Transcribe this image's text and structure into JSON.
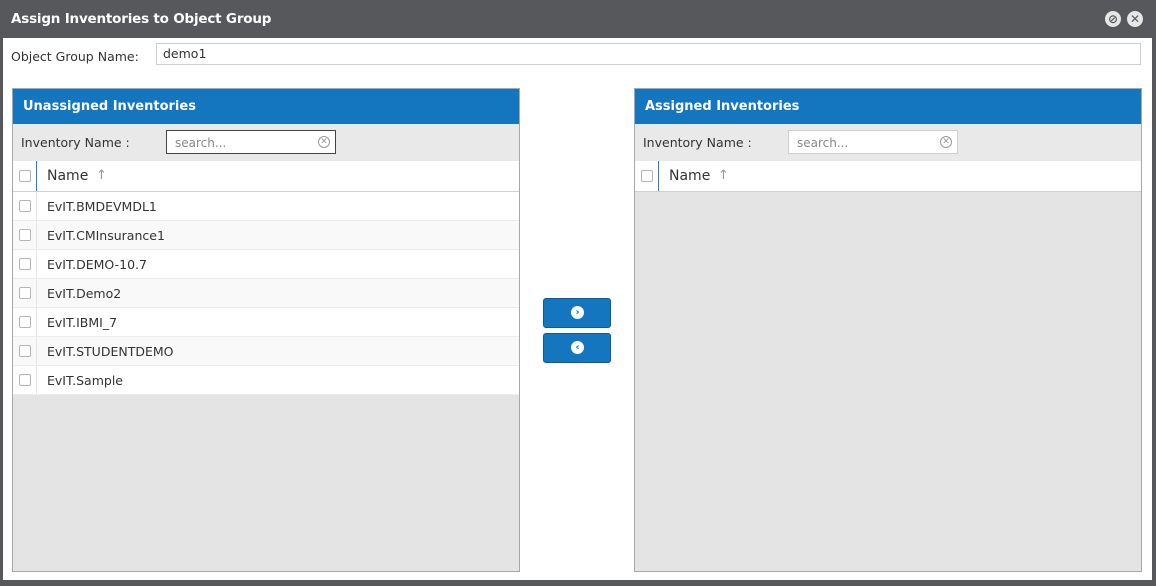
{
  "dialog": {
    "title": "Assign Inventories to Object Group",
    "minimize_icon": "collapse-icon",
    "close_icon": "close-icon"
  },
  "object_group": {
    "label": "Object Group Name:",
    "value": "demo1"
  },
  "unassigned": {
    "header": "Unassigned Inventories",
    "filter_label": "Inventory Name :",
    "search_placeholder": "search...",
    "column_name": "Name",
    "rows": [
      {
        "name": "EvIT.BMDEVMDL1"
      },
      {
        "name": "EvIT.CMInsurance1"
      },
      {
        "name": "EvIT.DEMO-10.7"
      },
      {
        "name": "EvIT.Demo2"
      },
      {
        "name": "EvIT.IBMI_7"
      },
      {
        "name": "EvIT.STUDENTDEMO"
      },
      {
        "name": "EvIT.Sample"
      }
    ]
  },
  "assigned": {
    "header": "Assigned Inventories",
    "filter_label": "Inventory Name :",
    "search_placeholder": "search...",
    "column_name": "Name",
    "rows": []
  },
  "actions": {
    "move_right_icon": "chevron-right-icon",
    "move_left_icon": "chevron-left-icon"
  },
  "colors": {
    "titlebar": "#56585b",
    "panel_header": "#1376bf",
    "button": "#1376bf"
  }
}
